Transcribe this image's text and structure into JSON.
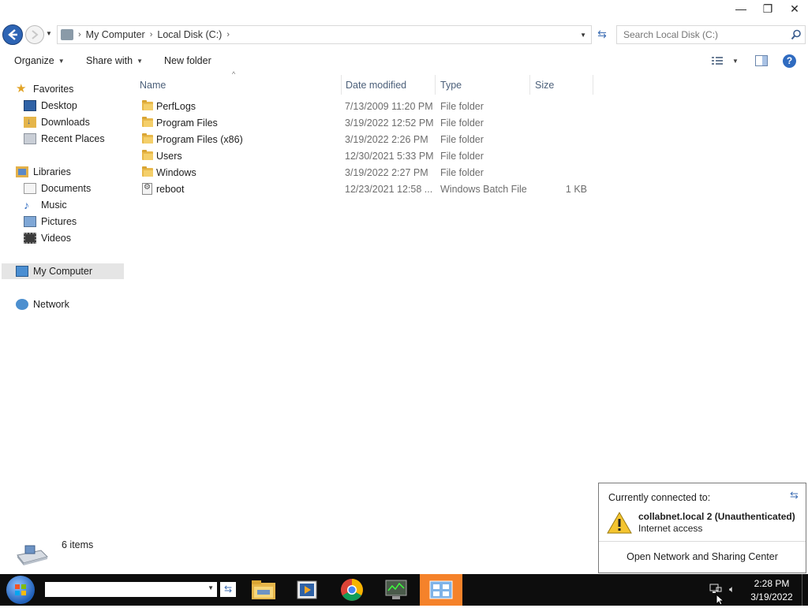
{
  "window": {
    "minimize": "—",
    "restore": "❐",
    "close": "✕"
  },
  "address": {
    "crumbs": [
      "My Computer",
      "Local Disk (C:)"
    ],
    "search_placeholder": "Search Local Disk (C:)"
  },
  "toolbar": {
    "organize": "Organize",
    "share_with": "Share with",
    "new_folder": "New folder"
  },
  "nav": {
    "favorites": "Favorites",
    "desktop": "Desktop",
    "downloads": "Downloads",
    "recent_places": "Recent Places",
    "libraries": "Libraries",
    "documents": "Documents",
    "music": "Music",
    "pictures": "Pictures",
    "videos": "Videos",
    "my_computer": "My Computer",
    "network": "Network"
  },
  "columns": {
    "name": "Name",
    "date_modified": "Date modified",
    "type": "Type",
    "size": "Size"
  },
  "files": [
    {
      "name": "PerfLogs",
      "date": "7/13/2009 11:20 PM",
      "type": "File folder",
      "size": ""
    },
    {
      "name": "Program Files",
      "date": "3/19/2022 12:52 PM",
      "type": "File folder",
      "size": ""
    },
    {
      "name": "Program Files (x86)",
      "date": "3/19/2022 2:26 PM",
      "type": "File folder",
      "size": ""
    },
    {
      "name": "Users",
      "date": "12/30/2021 5:33 PM",
      "type": "File folder",
      "size": ""
    },
    {
      "name": "Windows",
      "date": "3/19/2022 2:27 PM",
      "type": "File folder",
      "size": ""
    },
    {
      "name": "reboot",
      "date": "12/23/2021 12:58 ...",
      "type": "Windows Batch File",
      "size": "1 KB"
    }
  ],
  "status": {
    "item_count": "6 items"
  },
  "network_popup": {
    "heading": "Currently connected to:",
    "network_name": "collabnet.local  2 (Unauthenticated)",
    "access": "Internet access",
    "link": "Open Network and Sharing Center"
  },
  "taskbar": {
    "time": "2:28 PM",
    "date": "3/19/2022"
  },
  "colors": {
    "taskbar_bg": "#0d0d0d",
    "active_app_bg": "#f5822a",
    "header_text": "#4c607a"
  }
}
